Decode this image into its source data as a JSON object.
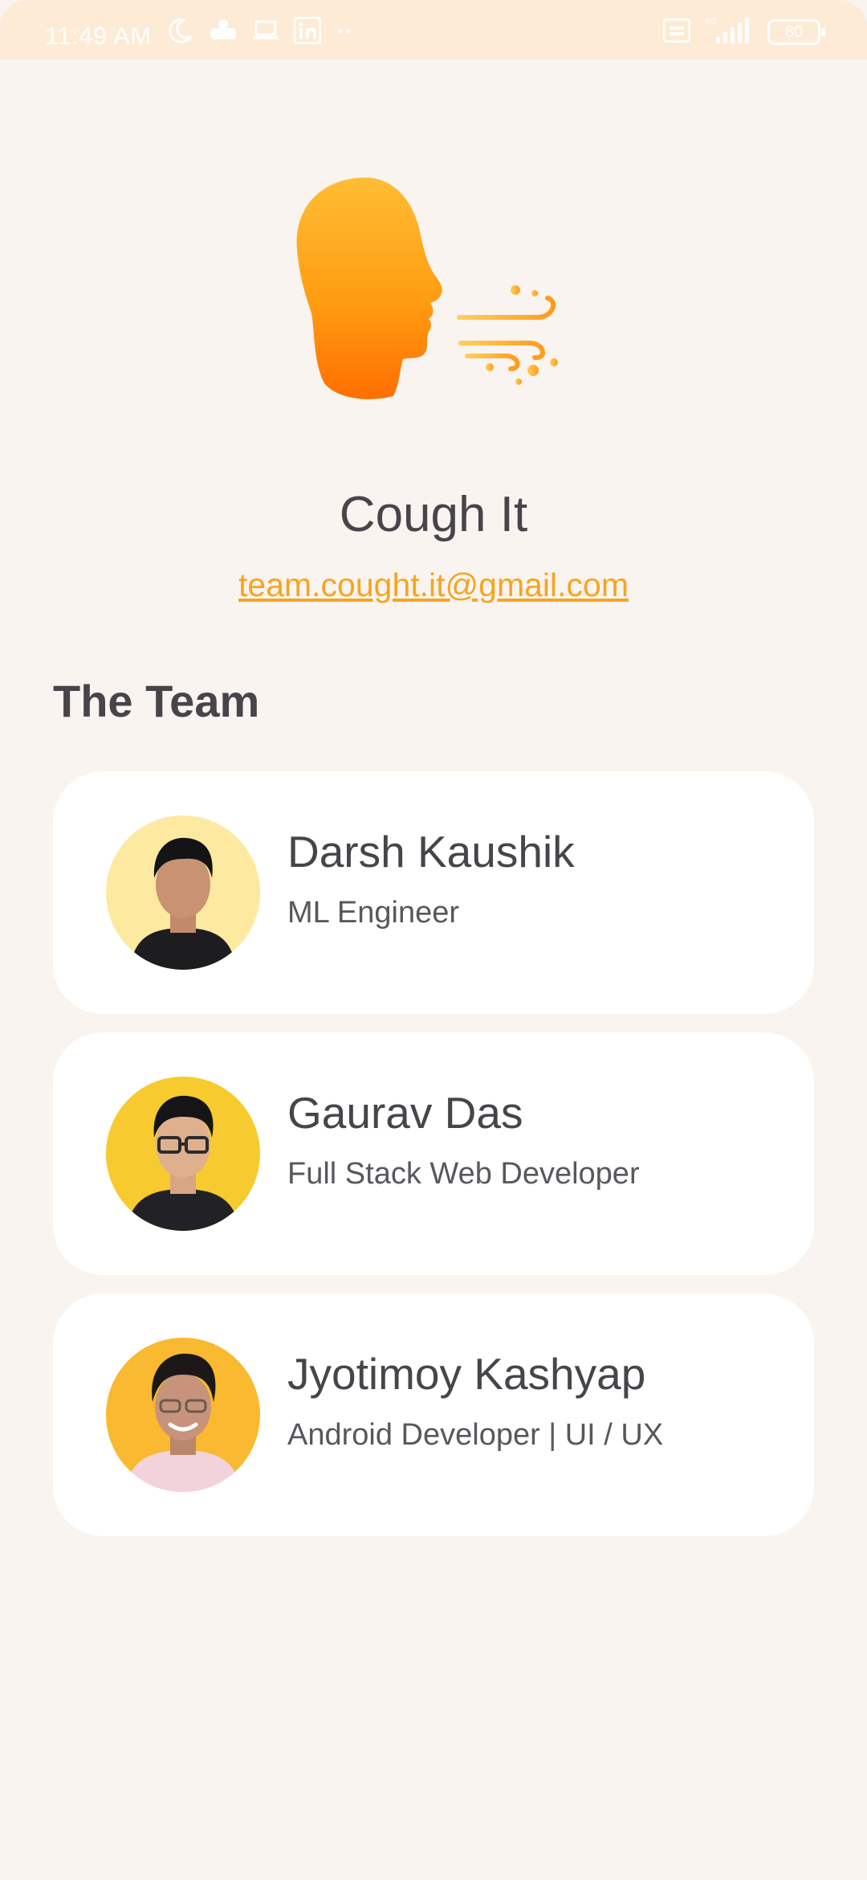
{
  "status_bar": {
    "time": "11:49 AM",
    "battery": "80",
    "network": "4G"
  },
  "app": {
    "name": "Cough It",
    "email": "team.cought.it@gmail.com",
    "logo_icon": "head-cough-icon"
  },
  "section": {
    "title": "The Team"
  },
  "team": [
    {
      "name": "Darsh Kaushik",
      "role": "ML Engineer",
      "avatar_bg": "#fde9a0"
    },
    {
      "name": "Gaurav Das",
      "role": "Full Stack Web Developer",
      "avatar_bg": "#f7cb2f"
    },
    {
      "name": "Jyotimoy Kashyap",
      "role": "Android Developer | UI / UX",
      "avatar_bg": "#f9b930"
    }
  ],
  "colors": {
    "background": "#faf4f1",
    "accent": "#f6a520",
    "text": "#47444a",
    "card": "#ffffff"
  }
}
